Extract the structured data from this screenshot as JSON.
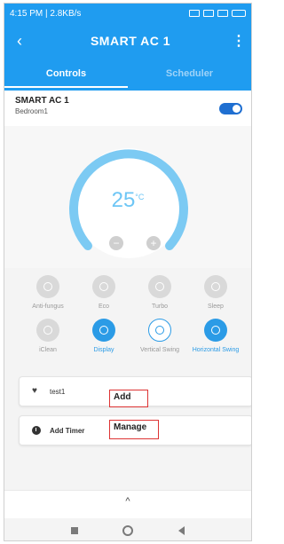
{
  "statusbar": {
    "left_text": "4:15 PM | 2.8KB/s"
  },
  "appbar": {
    "title": "SMART AC 1",
    "back_icon": "chevron-left",
    "more_icon": "vertical-dots"
  },
  "tabs": [
    {
      "label": "Controls",
      "active": true
    },
    {
      "label": "Scheduler",
      "active": false
    }
  ],
  "device": {
    "name": "SMART AC 1",
    "room": "Bedroom1",
    "power_on": true
  },
  "thermostat": {
    "temperature": "25",
    "unit": "°C",
    "minus": "−",
    "plus": "+"
  },
  "modes": [
    {
      "label": "Anti-fungus"
    },
    {
      "label": "Eco"
    },
    {
      "label": "Turbo"
    },
    {
      "label": "Sleep"
    },
    {
      "label": "iClean"
    },
    {
      "label": "Display"
    },
    {
      "label": "Vertical Swing"
    },
    {
      "label": "Horizontal Swing"
    }
  ],
  "schedule": [
    {
      "label": "test1"
    },
    {
      "label": "Add Timer"
    }
  ],
  "popup": {
    "add": "Add",
    "manage": "Manage"
  },
  "bottom_sheet": {
    "chevron": "^"
  }
}
